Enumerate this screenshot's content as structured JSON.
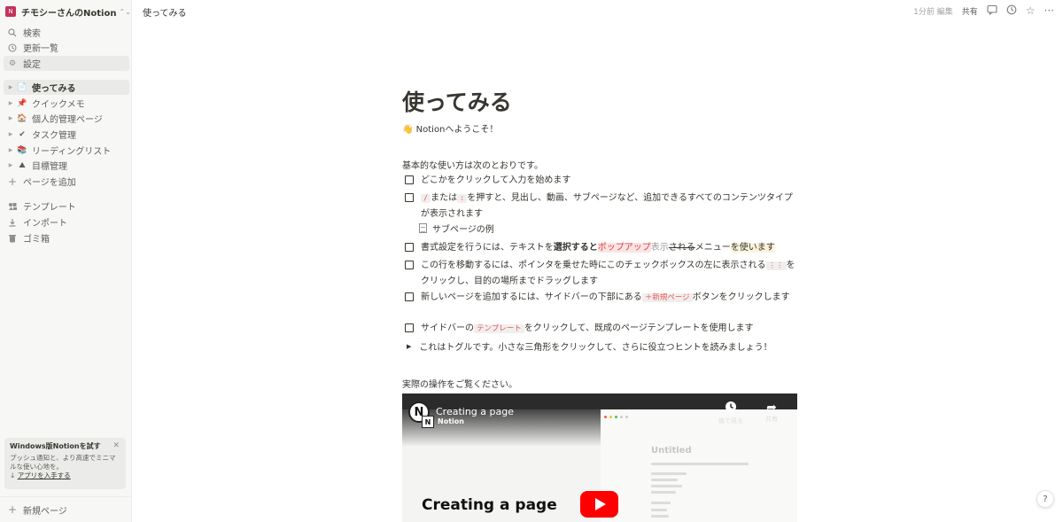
{
  "workspace": {
    "logo": "N",
    "name": "チモシーさんのNotion",
    "chevron": "chevron-updown-icon"
  },
  "sidebar": {
    "top": [
      {
        "icon": "search-icon",
        "label": "検索"
      },
      {
        "icon": "clock-icon",
        "label": "更新一覧"
      },
      {
        "icon": "gear-icon",
        "label": "設定"
      }
    ],
    "pages": [
      {
        "emoji": "📄",
        "label": "使ってみる",
        "active": true
      },
      {
        "emoji": "📌",
        "label": "クイックメモ"
      },
      {
        "emoji": "🏠",
        "label": "個人的管理ページ"
      },
      {
        "emoji": "✔",
        "label": "タスク管理"
      },
      {
        "emoji": "📚",
        "label": "リーディングリスト"
      },
      {
        "emoji": "⛰",
        "label": "目標管理"
      }
    ],
    "add_page": "ページを追加",
    "bottom": [
      {
        "icon": "template-icon",
        "label": "テンプレート"
      },
      {
        "icon": "import-icon",
        "label": "インポート"
      },
      {
        "icon": "trash-icon",
        "label": "ゴミ箱"
      }
    ],
    "promo": {
      "title": "Windows版Notionを試す",
      "body": "プッシュ通知と、より高速でミニマルな使い心地を。",
      "link": "アプリを入手する",
      "link_prefix": "↓"
    },
    "new_page": "新規ページ"
  },
  "topbar": {
    "breadcrumb": "使ってみる",
    "edited": "1分前 編集",
    "share": "共有"
  },
  "page": {
    "title": "使ってみる",
    "welcome_emoji": "👋",
    "welcome": "Notionへようこそ！",
    "intro": "基本的な使い方は次のとおりです。",
    "todos": {
      "t1": "どこかをクリックして入力を始めます",
      "t2_code1": "/",
      "t2_mid": "または",
      "t2_code2": ":",
      "t2_rest": "を押すと、見出し、動画、サブページなど、追加できるすべてのコンテンツタイプが表示されます",
      "subpage": "サブページの例",
      "t3_a": "書式設定を行うには、テキストを",
      "t3_bold": "選択すると",
      "t3_red": "ポップアップ",
      "t3_gray": "表示",
      "t3_strike": "される",
      "t3_plain": "メニュー",
      "t3_yellow": "を使います",
      "t4_a": "この行を移動するには、ポインタを乗せた時にこのチェックボックスの左に表示される",
      "t4_code": "⋮⋮",
      "t4_b": "をクリックし、目的の場所までドラッグします",
      "t5_a": "新しいページを追加するには、サイドバーの下部にある",
      "t5_code": "＋新規ページ",
      "t5_b": "ボタンをクリックします",
      "t6_a": "サイドバーの",
      "t6_code": "テンプレート",
      "t6_b": "をクリックして、既成のページテンプレートを使用します"
    },
    "toggle": "これはトグルです。小さな三角形をクリックして、さらに役立つヒントを読みましょう！",
    "caption": "実際の操作をご覧ください。"
  },
  "video": {
    "title": "Creating a page",
    "channel": "Notion",
    "watch_later": "後で見る",
    "share": "共有",
    "big_title": "Creating a page",
    "screen_title": "Untitled"
  },
  "help": "?"
}
